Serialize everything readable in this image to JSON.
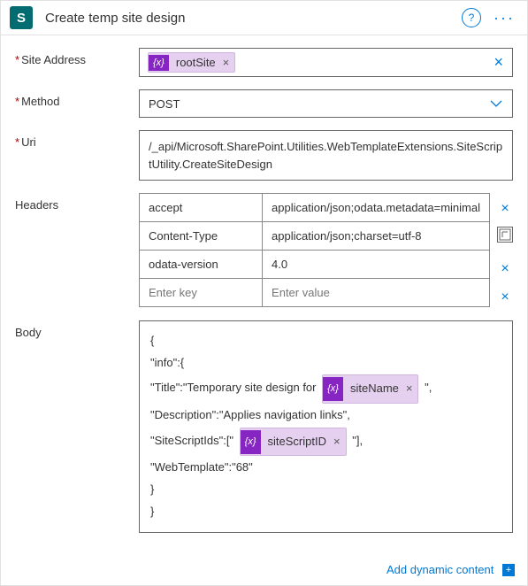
{
  "header": {
    "logo_letter": "S",
    "title": "Create temp site design",
    "help_aria": "?",
    "more_aria": "···"
  },
  "labels": {
    "site_address": "Site Address",
    "method": "Method",
    "uri": "Uri",
    "headers": "Headers",
    "body": "Body"
  },
  "site_address": {
    "token": "rootSite",
    "token_remove": "×",
    "clear": "×"
  },
  "method": {
    "value": "POST"
  },
  "uri": {
    "value": "/_api/Microsoft.SharePoint.Utilities.WebTemplateExtensions.SiteScriptUtility.CreateSiteDesign"
  },
  "headers_tbl": {
    "rows": [
      {
        "key": "accept",
        "value": "application/json;odata.metadata=minimal"
      },
      {
        "key": "Content-Type",
        "value": "application/json;charset=utf-8"
      },
      {
        "key": "odata-version",
        "value": "4.0"
      }
    ],
    "placeholder_key": "Enter key",
    "placeholder_value": "Enter value",
    "remove": "×",
    "json_toggle_aria": "T"
  },
  "body_text": {
    "l1": "{",
    "l2": "\"info\":{",
    "l3_pre": "\"Title\":\"Temporary site design for ",
    "l3_token": "siteName",
    "l3_post": "\",",
    "l4": "\"Description\":\"Applies navigation links\",",
    "l5_pre": "\"SiteScriptIds\":[\"",
    "l5_token": "siteScriptID",
    "l5_post": "\"],",
    "l6": "\"WebTemplate\":\"68\"",
    "l7": "}",
    "l8": "}",
    "token_remove": "×"
  },
  "fx_badge": "{x}",
  "footer": {
    "add_dynamic": "Add dynamic content",
    "plus": "+"
  }
}
